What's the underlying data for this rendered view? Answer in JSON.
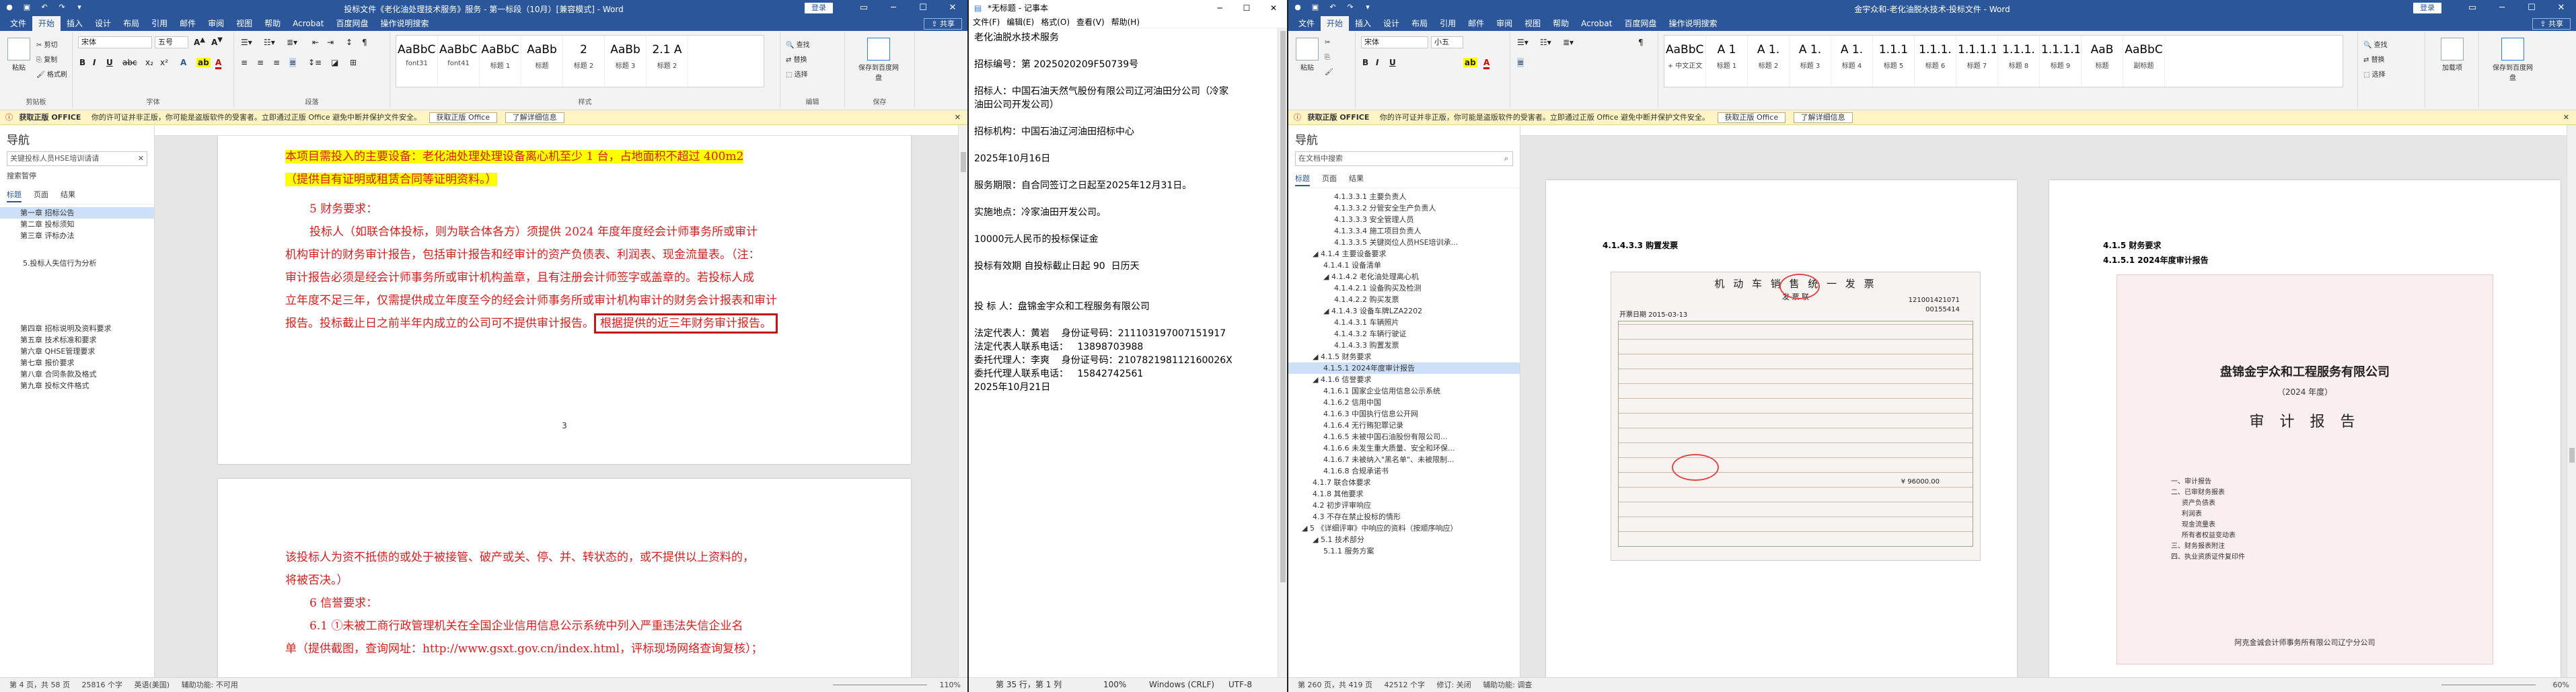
{
  "left_word": {
    "title": "投标文件《老化油处理技术服务》服务 - 第一标段（10月）[兼容模式] - Word",
    "login_label": "登录",
    "share_label": "共享",
    "tabs": [
      "文件",
      "开始",
      "插入",
      "设计",
      "布局",
      "引用",
      "邮件",
      "审阅",
      "视图",
      "帮助",
      "Acrobat",
      "百度网盘",
      "操作说明搜索"
    ],
    "active_tab": "开始",
    "ribbon": {
      "paste": "粘贴",
      "cut": "剪切",
      "copy": "复制",
      "format_painter": "格式刷",
      "clipboard": "剪贴板",
      "font_name": "宋体",
      "font_size": "五号",
      "font": "字体",
      "paragraph": "段落",
      "styles_group": "样式",
      "styles": [
        {
          "preview": "AaBbCcC",
          "name": "font31"
        },
        {
          "preview": "AaBbCcC",
          "name": "font41"
        },
        {
          "preview": "AaBbC",
          "name": "标题 1"
        },
        {
          "preview": "AaBb",
          "name": "标题"
        },
        {
          "preview": "2",
          "name": "标题 2"
        },
        {
          "preview": "AaBb",
          "name": "标题 3"
        },
        {
          "preview": "2.1 A",
          "name": "标题 2"
        }
      ],
      "find": "查找",
      "replace": "替换",
      "select": "选择",
      "editing": "编辑",
      "save_baidu": "保存到百度网盘",
      "save": "保存"
    },
    "msgbar": {
      "label": "获取正版 OFFICE",
      "text": "你的许可证并非正版，你可能是盗版软件的受害者。立即通过正版 Office 避免中断并保护文件安全。",
      "btn1": "获取正版 Office",
      "btn2": "了解详细信息"
    },
    "nav": {
      "title": "导航",
      "search_value": "关键投标人员HSE培训请请",
      "search_result": "搜索暂停",
      "tabs": [
        "标题",
        "页面",
        "结果"
      ],
      "items": [
        {
          "text": "第一章 招标公告",
          "selected": true
        },
        {
          "text": "第二章 投标须知",
          "selected": false
        },
        {
          "text": "第三章 评标办法",
          "selected": false
        },
        {
          "text": "5.投标人失信行为分析",
          "selected": false
        },
        {
          "text": "第四章 招标说明及资料要求",
          "selected": false
        },
        {
          "text": "第五章 技术标准和要求",
          "selected": false
        },
        {
          "text": "第六章 QHSE管理要求",
          "selected": false
        },
        {
          "text": "第七章 报价要求",
          "selected": false
        },
        {
          "text": "第八章 合同条款及格式",
          "selected": false
        },
        {
          "text": "第九章 投标文件格式",
          "selected": false
        }
      ]
    },
    "page1": {
      "line1": "本项目需投入的主要设备：老化油处理处理设备离心机至少 1 台，占地面积不超过 400m2",
      "line2": "（提供自有证明或租赁合同等证明资料。）",
      "heading": "5 财务要求：",
      "para": [
        "投标人（如联合体投标，则为联合体各方）须提供 2024 年度年度经会计师事务所或审计",
        "机构审计的财务审计报告，包括审计报告和经审计的资产负债表、利润表、现金流量表。（注：",
        "审计报告必须是经会计师事务所或审计机构盖章，且有注册会计师签字或盖章的。若投标人成",
        "立年度不足三年，仅需提供成立年度至今的经会计师事务所或审计机构审计的财务会计报表和审计",
        "报告。投标截止日之前半年内成立的公司可不提供审计报告。"
      ],
      "boxed": "根据提供的近三年财务审计报告。",
      "page_num": "3"
    },
    "page2": {
      "line1": "该投标人为资不抵债的或处于被接管、破产或关、停、并、转状态的，或不提供以上资料的，",
      "line2": "将被否决。）",
      "heading": "6 信誉要求：",
      "line3": "6.1 ①未被工商行政管理机关在全国企业信用信息公示系统中列入严重违法失信企业名",
      "line4": "单（提供截图，查询网址：http://www.gsxt.gov.cn/index.html，评标现场网络查询复核）；"
    },
    "status": {
      "page": "第 4 页，共 58 页",
      "words": "25816 个字",
      "lang": "英语(美国)",
      "accessibility": "辅助功能: 不可用",
      "zoom": "110%"
    }
  },
  "notepad": {
    "title": "*无标题 - 记事本",
    "menu": [
      "文件(F)",
      "编辑(E)",
      "格式(O)",
      "查看(V)",
      "帮助(H)"
    ],
    "lines": [
      "老化油脱水技术服务",
      "",
      "招标编号：第 2025020209F50739号",
      "",
      "招标人：中国石油天然气股份有限公司辽河油田分公司（冷家",
      "油田公司开发公司）",
      "",
      "招标机构：中国石油辽河油田招标中心",
      "",
      "2025年10月16日",
      "",
      "服务期限：自合同签订之日起至2025年12月31日。",
      "",
      "实施地点：冷家油田开发公司。",
      "",
      "10000元人民币的投标保证金",
      "",
      "投标有效期 自投标截止日起 90  日历天",
      "",
      "",
      "投 标 人：盘锦金宇众和工程服务有限公司",
      "",
      "法定代表人：黄岩    身份证号码：211103197007151917",
      "法定代表人联系电话：   13898703988",
      "委托代理人：李爽    身份证号码：210782198112160026X",
      "委托代理人联系电话：   15842742561",
      "2025年10月21日"
    ],
    "status": {
      "pos": "第 35 行，第 1 列",
      "zoom": "100%",
      "eol": "Windows (CRLF)",
      "enc": "UTF-8"
    }
  },
  "right_word": {
    "title": "金宇众和-老化油脱水技术-投标文件 - Word",
    "login_label": "登录",
    "share_label": "共享",
    "tabs": [
      "文件",
      "开始",
      "插入",
      "设计",
      "布局",
      "引用",
      "邮件",
      "审阅",
      "视图",
      "帮助",
      "Acrobat",
      "百度网盘",
      "操作说明搜索"
    ],
    "active_tab": "开始",
    "ribbon": {
      "paste": "粘贴",
      "font_name": "宋体",
      "font_size": "小五",
      "styles": [
        {
          "preview": "AaBbCcDd",
          "name": "+ 中文正文"
        },
        {
          "preview": "A 1",
          "name": "标题 1"
        },
        {
          "preview": "A 1.",
          "name": "标题 2"
        },
        {
          "preview": "A 1.",
          "name": "标题 3"
        },
        {
          "preview": "A 1.",
          "name": "标题 4"
        },
        {
          "preview": "1.1.1",
          "name": "标题 5"
        },
        {
          "preview": "1.1.1.",
          "name": "标题 6"
        },
        {
          "preview": "1.1.1.1",
          "name": "标题 7"
        },
        {
          "preview": "1.1.1.",
          "name": "标题 8"
        },
        {
          "preview": "1.1.1.1",
          "name": "标题 9"
        },
        {
          "preview": "AaB",
          "name": "标题"
        },
        {
          "preview": "AaBbC",
          "name": "副标题"
        }
      ],
      "find": "查找",
      "replace": "替换",
      "select": "选择",
      "add": "加载项",
      "save_baidu": "保存到百度网盘"
    },
    "msgbar": {
      "label": "获取正版 OFFICE",
      "text": "你的许可证并非正版，你可能是盗版软件的受害者。立即通过正版 Office 避免中断并保护文件安全。",
      "btn1": "获取正版 Office",
      "btn2": "了解详细信息"
    },
    "nav": {
      "title": "导航",
      "search_placeholder": "在文档中搜索",
      "tabs": [
        "标题",
        "页面",
        "结果"
      ],
      "items": [
        {
          "text": "4.1.3.3.1 主要负责人",
          "indent": 3,
          "selected": false
        },
        {
          "text": "4.1.3.3.2 分管安全生产负责人",
          "indent": 3,
          "selected": false
        },
        {
          "text": "4.1.3.3.3 安全管理人员",
          "indent": 3,
          "selected": false
        },
        {
          "text": "4.1.3.3.4 施工项目负责人",
          "indent": 3,
          "selected": false
        },
        {
          "text": "4.1.3.3.5 关键岗位人员HSE培训承...",
          "indent": 3,
          "selected": false
        },
        {
          "text": "◢ 4.1.4 主要设备要求",
          "indent": 1,
          "selected": false
        },
        {
          "text": "4.1.4.1 设备清单",
          "indent": 2,
          "selected": false
        },
        {
          "text": "◢ 4.1.4.2 老化油处理离心机",
          "indent": 2,
          "selected": false
        },
        {
          "text": "4.1.4.2.1 设备购买及检测",
          "indent": 3,
          "selected": false
        },
        {
          "text": "4.1.4.2.2 购买发票",
          "indent": 3,
          "selected": false
        },
        {
          "text": "◢ 4.1.4.3 设备车牌LZA2202",
          "indent": 2,
          "selected": false
        },
        {
          "text": "4.1.4.3.1 车辆照片",
          "indent": 3,
          "selected": false
        },
        {
          "text": "4.1.4.3.2 车辆行驶证",
          "indent": 3,
          "selected": false
        },
        {
          "text": "4.1.4.3.3 购置发票",
          "indent": 3,
          "selected": false
        },
        {
          "text": "◢ 4.1.5 财务要求",
          "indent": 1,
          "selected": false
        },
        {
          "text": "4.1.5.1 2024年度审计报告",
          "indent": 2,
          "selected": true
        },
        {
          "text": "◢ 4.1.6 信誉要求",
          "indent": 1,
          "selected": false
        },
        {
          "text": "4.1.6.1 国家企业信用信息公示系统",
          "indent": 2,
          "selected": false
        },
        {
          "text": "4.1.6.2 信用中国",
          "indent": 2,
          "selected": false
        },
        {
          "text": "4.1.6.3 中国执行信息公开网",
          "indent": 2,
          "selected": false
        },
        {
          "text": "4.1.6.4 无行贿犯罪记录",
          "indent": 2,
          "selected": false
        },
        {
          "text": "4.1.6.5 未被中国石油股份有限公司...",
          "indent": 2,
          "selected": false
        },
        {
          "text": "4.1.6.6 未发生重大质量、安全和环保...",
          "indent": 2,
          "selected": false
        },
        {
          "text": "4.1.6.7 未被纳入\"黑名单\"、未被限制...",
          "indent": 2,
          "selected": false
        },
        {
          "text": "4.1.6.8 合规承诺书",
          "indent": 2,
          "selected": false
        },
        {
          "text": "4.1.7 联合体要求",
          "indent": 1,
          "selected": false
        },
        {
          "text": "4.1.8 其他要求",
          "indent": 1,
          "selected": false
        },
        {
          "text": "4.2 初步评审响应",
          "indent": 1,
          "selected": false
        },
        {
          "text": "4.3 不存在禁止投标的情形",
          "indent": 1,
          "selected": false
        },
        {
          "text": "◢ 5 《详细评审》中响应的资料（按顺序响应）",
          "indent": 0,
          "selected": false
        },
        {
          "text": "◢ 5.1 技术部分",
          "indent": 1,
          "selected": false
        },
        {
          "text": "5.1.1 服务方案",
          "indent": 2,
          "selected": false
        }
      ]
    },
    "page_left": {
      "heading": "4.1.4.3.3 购置发票",
      "invoice_title": "机 动 车 销 售 统 一 发 票",
      "invoice_sub": "发 票 联",
      "invoice_code": "121001421071",
      "invoice_no": "00155414",
      "date": "开票日期 2015-03-13",
      "amount": "¥ 96000.00"
    },
    "page_right": {
      "heading1": "4.1.5 财务要求",
      "heading2": "4.1.5.1 2024年度审计报告",
      "company": "盘锦金宇众和工程服务有限公司",
      "year": "（2024 年度）",
      "report_title": "审 计 报 告",
      "toc": [
        "一、审计报告",
        "二、已审财务报表",
        "资产负债表",
        "利润表",
        "现金流量表",
        "所有者权益变动表",
        "三、财务报表附注",
        "四、执业资质证件复印件"
      ],
      "footer": "阿克金诚会计师事务所有限公司辽宁分公司"
    },
    "status": {
      "page": "第 260 页，共 419 页",
      "words": "42512 个字",
      "track": "修订: 关闭",
      "accessibility": "辅助功能: 调查",
      "zoom": "60%"
    }
  }
}
